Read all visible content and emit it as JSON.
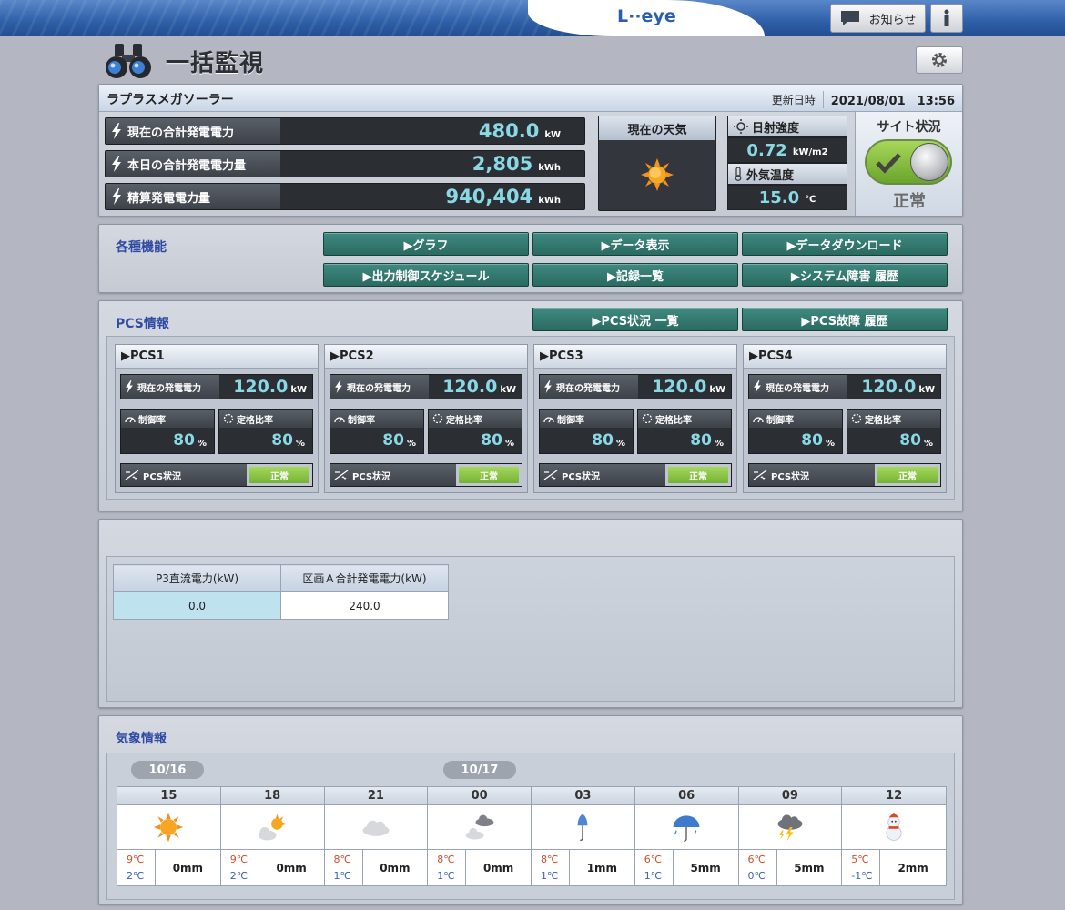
{
  "header": {
    "logo": "L··eye",
    "notice_label": "お知らせ"
  },
  "page": {
    "title": "一括監視"
  },
  "site": {
    "name": "ラプラスメガソーラー",
    "update_label": "更新日時",
    "update_value": "2021/08/01　13:56",
    "current_power": {
      "label": "現在の合計発電電力",
      "value": "480.0",
      "unit": "kW"
    },
    "today_energy": {
      "label": "本日の合計発電電力量",
      "value": "2,805",
      "unit": "kWh"
    },
    "total_energy": {
      "label": "精算発電電力量",
      "value": "940,404",
      "unit": "kWh"
    },
    "weather_now": {
      "label": "現在の天気",
      "icon": "sun-icon"
    },
    "irradiance": {
      "label": "日射強度",
      "value": "0.72",
      "unit": "kW/m2"
    },
    "outdoor_temp": {
      "label": "外気温度",
      "value": "15.0",
      "unit": "℃"
    },
    "status": {
      "label": "サイト状況",
      "value": "正常",
      "state_color": "#8bc34a"
    }
  },
  "functions": {
    "title": "各種機能",
    "buttons": [
      "▶グラフ",
      "▶データ表示",
      "▶データダウンロード",
      "▶出力制御スケジュール",
      "▶記録一覧",
      "▶システム障害 履歴"
    ]
  },
  "pcs_info": {
    "title": "PCS情報",
    "buttons": [
      "▶PCS状況 一覧",
      "▶PCS故障 履歴"
    ],
    "units": [
      {
        "name": "▶PCS1",
        "power_label": "現在の発電電力",
        "power": "120.0",
        "power_unit": "kW",
        "control_label": "制御率",
        "control": "80",
        "rated_label": "定格比率",
        "rated": "80",
        "pct": "%",
        "status_label": "PCS状況",
        "status": "正常"
      },
      {
        "name": "▶PCS2",
        "power_label": "現在の発電電力",
        "power": "120.0",
        "power_unit": "kW",
        "control_label": "制御率",
        "control": "80",
        "rated_label": "定格比率",
        "rated": "80",
        "pct": "%",
        "status_label": "PCS状況",
        "status": "正常"
      },
      {
        "name": "▶PCS3",
        "power_label": "現在の発電電力",
        "power": "120.0",
        "power_unit": "kW",
        "control_label": "制御率",
        "control": "80",
        "rated_label": "定格比率",
        "rated": "80",
        "pct": "%",
        "status_label": "PCS状況",
        "status": "正常"
      },
      {
        "name": "▶PCS4",
        "power_label": "現在の発電電力",
        "power": "120.0",
        "power_unit": "kW",
        "control_label": "制御率",
        "control": "80",
        "rated_label": "定格比率",
        "rated": "80",
        "pct": "%",
        "status_label": "PCS状況",
        "status": "正常"
      }
    ]
  },
  "data_table": {
    "headers": [
      "P3直流電力(kW)",
      "区画Ａ合計発電電力(kW)"
    ],
    "values": [
      "0.0",
      "240.0"
    ]
  },
  "weather": {
    "title": "気象情報",
    "dates": [
      "10/16",
      "10/17"
    ],
    "hours": [
      {
        "hour": "15",
        "icon": "sun-icon",
        "hi": "9℃",
        "lo": "2℃",
        "rain": "0mm"
      },
      {
        "hour": "18",
        "icon": "sun-cloud-icon",
        "hi": "9℃",
        "lo": "2℃",
        "rain": "0mm"
      },
      {
        "hour": "21",
        "icon": "cloud-icon",
        "hi": "8℃",
        "lo": "1℃",
        "rain": "0mm"
      },
      {
        "hour": "00",
        "icon": "dark-cloud-icon",
        "hi": "8℃",
        "lo": "1℃",
        "rain": "0mm"
      },
      {
        "hour": "03",
        "icon": "umbrella-icon",
        "hi": "8℃",
        "lo": "1℃",
        "rain": "1mm"
      },
      {
        "hour": "06",
        "icon": "umbrella-rain-icon",
        "hi": "6℃",
        "lo": "1℃",
        "rain": "5mm"
      },
      {
        "hour": "09",
        "icon": "thunder-cloud-icon",
        "hi": "6℃",
        "lo": "0℃",
        "rain": "5mm"
      },
      {
        "hour": "12",
        "icon": "snowman-icon",
        "hi": "5℃",
        "lo": "-1℃",
        "rain": "2mm"
      }
    ]
  }
}
